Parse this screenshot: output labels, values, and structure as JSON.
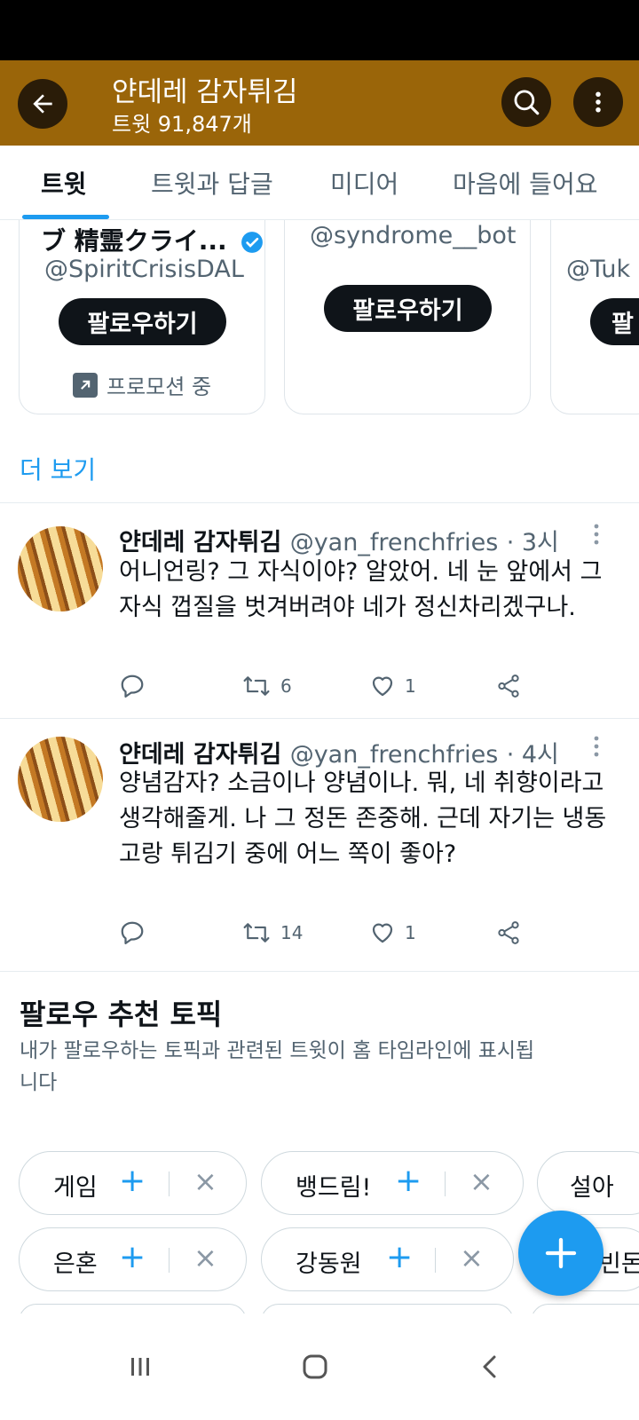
{
  "header": {
    "title": "얀데레 감자튀김",
    "subtitle": "트윗 91,847개"
  },
  "tabs": [
    {
      "label": "트윗",
      "active": true
    },
    {
      "label": "트윗과 답글",
      "active": false
    },
    {
      "label": "미디어",
      "active": false
    },
    {
      "label": "마음에 들어요",
      "active": false
    }
  ],
  "suggestions": {
    "cards": [
      {
        "name": "ブ 精霊クライ...",
        "handle": "@SpiritCrisisDAL",
        "follow_label": "팔로우하기",
        "promo_label": "프로모션 중",
        "verified": true
      },
      {
        "name": "",
        "handle": "@syndrome__bot",
        "follow_label": "팔로우하기"
      },
      {
        "handle": "@Tuk",
        "follow_label": "팔"
      }
    ],
    "see_more": "더 보기"
  },
  "tweets": [
    {
      "name": "얀데레 감자튀김",
      "handle": "@yan_frenchfries",
      "time": "· 3시",
      "body": "어니언링? 그 자식이야? 알았어. 네 눈 앞에서 그 자식 껍질을 벗겨버려야 네가 정신차리겠구나.",
      "retweets": "6",
      "likes": "1"
    },
    {
      "name": "얀데레 감자튀김",
      "handle": "@yan_frenchfries",
      "time": "· 4시",
      "body": "양념감자? 소금이나 양념이나. 뭐, 네 취향이라고 생각해줄게. 나 그 정돈 존중해. 근데 자기는 냉동고랑 튀김기 중에 어느 쪽이 좋아?",
      "retweets": "14",
      "likes": "1"
    }
  ],
  "topics": {
    "title": "팔로우 추천 토픽",
    "description": "내가 팔로우하는 토픽과 관련된 트윗이 홈 타임라인에 표시됩니다",
    "chips": [
      "게임",
      "뱅드림!",
      "설아",
      "은혼",
      "강동원",
      "빈돈"
    ]
  },
  "colors": {
    "header_bg": "#9a6509",
    "accent": "#1d9bf0",
    "text_primary": "#0f1419",
    "text_secondary": "#536471"
  },
  "icons": [
    "back-arrow-icon",
    "search-icon",
    "more-vertical-icon",
    "verified-badge-icon",
    "promoted-arrow-icon",
    "reply-icon",
    "retweet-icon",
    "like-icon",
    "share-icon",
    "plus-icon",
    "close-icon",
    "recents-icon",
    "home-icon",
    "nav-back-icon"
  ]
}
